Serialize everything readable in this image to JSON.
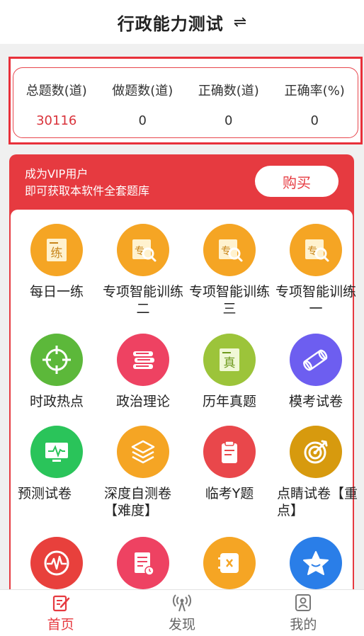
{
  "header": {
    "title": "行政能力测试",
    "swap_icon": "⇌"
  },
  "stats": [
    {
      "label": "总题数(道)",
      "value": "30116"
    },
    {
      "label": "做题数(道)",
      "value": "0"
    },
    {
      "label": "正确数(道)",
      "value": "0"
    },
    {
      "label": "正确率(%)",
      "value": "0"
    }
  ],
  "vip": {
    "line1": "成为VIP用户",
    "line2": "即可获取本软件全套题库",
    "buy_label": "购买"
  },
  "grid": [
    {
      "label": "每日一练",
      "icon": "practice-icon",
      "color": "#f5a524"
    },
    {
      "label": "专项智能训练二",
      "icon": "special-training-icon",
      "color": "#f5a524"
    },
    {
      "label": "专项智能训练三",
      "icon": "special-training-icon",
      "color": "#f5a524"
    },
    {
      "label": "专项智能训练一",
      "icon": "special-training-icon",
      "color": "#f5a524"
    },
    {
      "label": "时政热点",
      "icon": "target-icon",
      "color": "#5cb83a"
    },
    {
      "label": "政治理论",
      "icon": "books-icon",
      "color": "#ee4262"
    },
    {
      "label": "历年真题",
      "icon": "real-exam-icon",
      "color": "#9cc43a"
    },
    {
      "label": "模考试卷",
      "icon": "scroll-icon",
      "color": "#6d5ef0"
    },
    {
      "label": "预测试卷",
      "icon": "monitor-icon",
      "color": "#2ac45a"
    },
    {
      "label": "深度自测卷【难度】",
      "icon": "layers-icon",
      "color": "#f5a524"
    },
    {
      "label": "临考Y题",
      "icon": "clipboard-icon",
      "color": "#e9474b"
    },
    {
      "label": "点睛试卷【重点】",
      "icon": "bullseye-icon",
      "color": "#d79a0e"
    },
    {
      "label": "",
      "icon": "heartbeat-icon",
      "color": "#e8403c"
    },
    {
      "label": "",
      "icon": "document-clock-icon",
      "color": "#ee4262"
    },
    {
      "label": "",
      "icon": "notebook-x-icon",
      "color": "#f5a524"
    },
    {
      "label": "",
      "icon": "star-icon",
      "color": "#2a7ee8"
    }
  ],
  "nav": [
    {
      "label": "首页",
      "icon": "edit-icon",
      "active": true
    },
    {
      "label": "发现",
      "icon": "signal-icon",
      "active": false
    },
    {
      "label": "我的",
      "icon": "profile-icon",
      "active": false
    }
  ],
  "colors": {
    "accent": "#e63a40",
    "stat_highlight": "#d9333b"
  }
}
